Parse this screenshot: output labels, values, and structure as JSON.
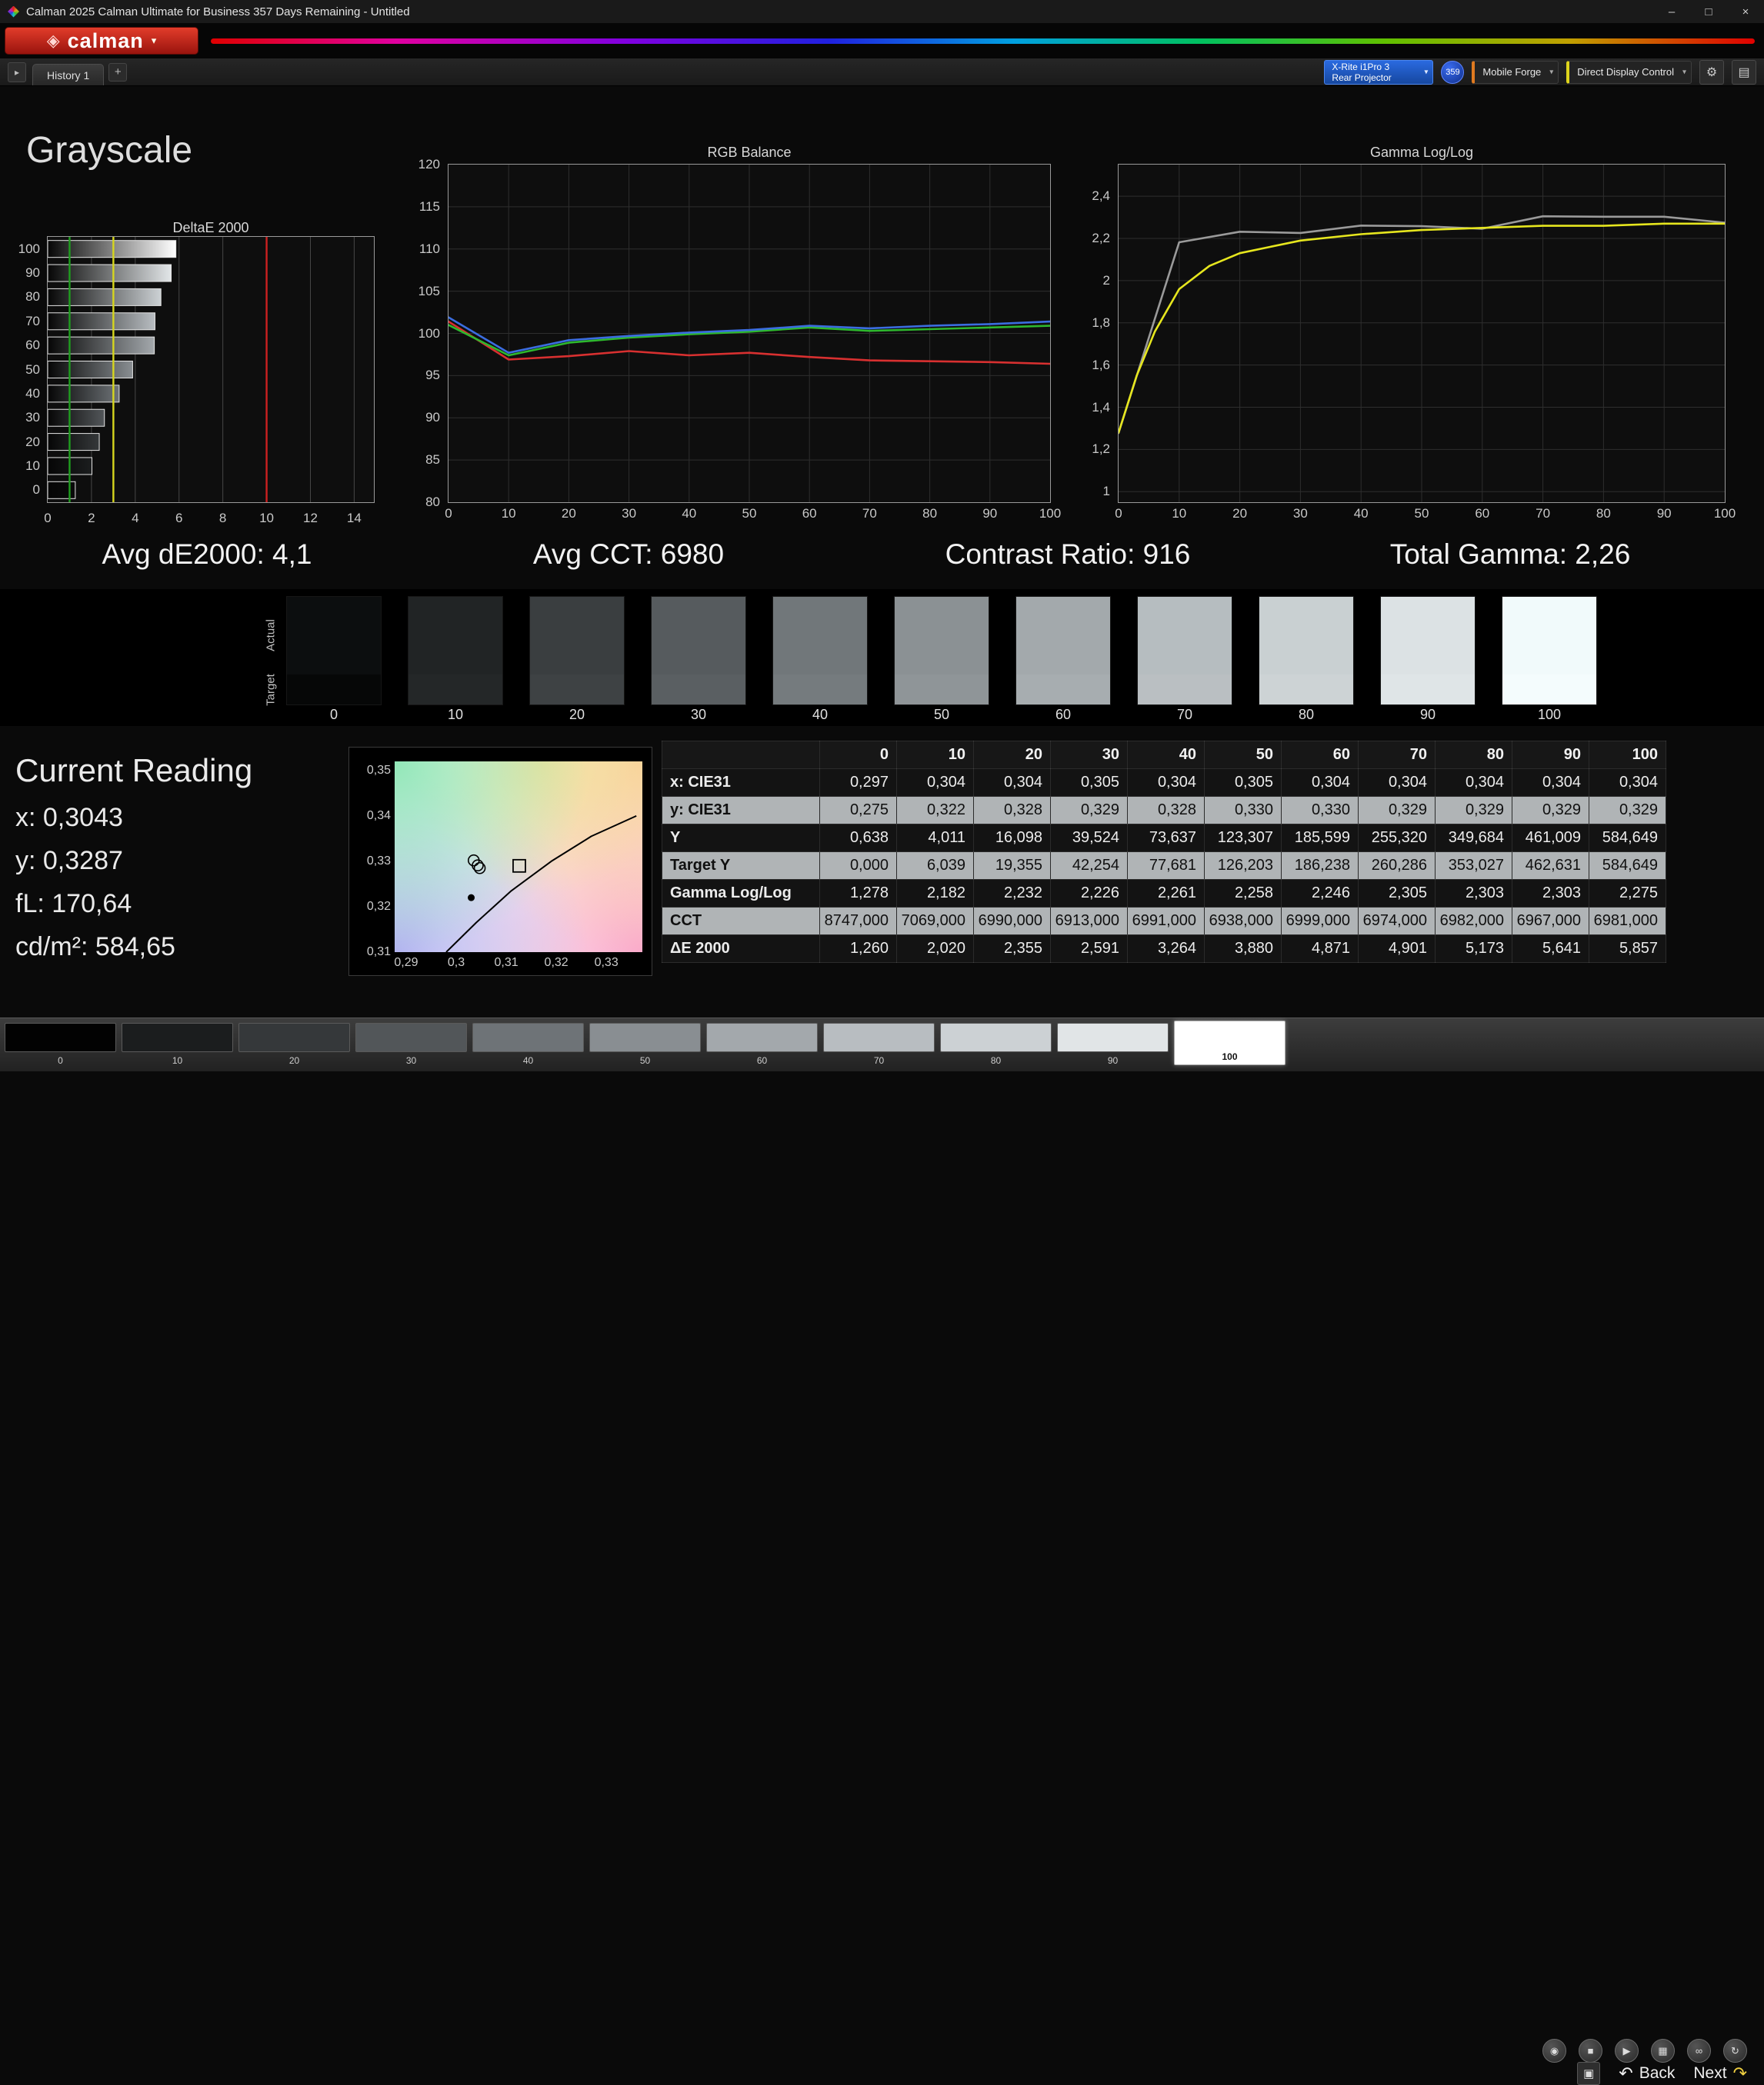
{
  "window": {
    "title": "Calman 2025 Calman Ultimate for Business 357 Days Remaining  - Untitled",
    "minimize": "–",
    "maximize": "□",
    "close": "×"
  },
  "brand": {
    "name": "calman",
    "gem": "◈",
    "caret": "▾"
  },
  "toolbar": {
    "expander": "▸",
    "history_tab": "History 1",
    "add": "+",
    "meter": {
      "line1": "X-Rite i1Pro 3",
      "line2": "Rear Projector"
    },
    "badge": "359",
    "source": "Mobile Forge",
    "display": "Direct Display Control",
    "gear": "⚙",
    "panel": "▤",
    "caret": "▾"
  },
  "page": {
    "title": "Grayscale"
  },
  "summary": {
    "avg_de": "Avg dE2000: 4,1",
    "avg_cct": "Avg CCT: 6980",
    "contrast": "Contrast Ratio: 916",
    "total_gamma": "Total Gamma: 2,26"
  },
  "current_reading": {
    "title": "Current Reading",
    "lines": [
      "x: 0,3043",
      "y: 0,3287",
      "fL: 170,64",
      "cd/m²: 584,65"
    ]
  },
  "swatch_strip": {
    "row_labels": [
      "Actual",
      "Target"
    ],
    "steps": [
      {
        "label": "0",
        "actual": "#0c0e0f",
        "target": "#060707"
      },
      {
        "label": "10",
        "actual": "#212425",
        "target": "#242728"
      },
      {
        "label": "20",
        "actual": "#3a3e40",
        "target": "#3e4244"
      },
      {
        "label": "30",
        "actual": "#565b5e",
        "target": "#5a5f62"
      },
      {
        "label": "40",
        "actual": "#71777a",
        "target": "#757b7e"
      },
      {
        "label": "50",
        "actual": "#8b9194",
        "target": "#8f9598"
      },
      {
        "label": "60",
        "actual": "#a3a9ac",
        "target": "#a7adb0"
      },
      {
        "label": "70",
        "actual": "#b6bdc0",
        "target": "#babfc2"
      },
      {
        "label": "80",
        "actual": "#c9d0d2",
        "target": "#cdd3d5"
      },
      {
        "label": "90",
        "actual": "#dce2e4",
        "target": "#dfe5e7"
      },
      {
        "label": "100",
        "actual": "#f1fafb",
        "target": "#f4fcfd"
      }
    ]
  },
  "table": {
    "columns": [
      "0",
      "10",
      "20",
      "30",
      "40",
      "50",
      "60",
      "70",
      "80",
      "90",
      "100"
    ],
    "rows": [
      {
        "label": "x: CIE31",
        "tone": "dark",
        "values": [
          "0,297",
          "0,304",
          "0,304",
          "0,305",
          "0,304",
          "0,305",
          "0,304",
          "0,304",
          "0,304",
          "0,304",
          "0,304"
        ]
      },
      {
        "label": "y: CIE31",
        "tone": "light",
        "values": [
          "0,275",
          "0,322",
          "0,328",
          "0,329",
          "0,328",
          "0,330",
          "0,330",
          "0,329",
          "0,329",
          "0,329",
          "0,329"
        ]
      },
      {
        "label": "Y",
        "tone": "dark",
        "values": [
          "0,638",
          "4,011",
          "16,098",
          "39,524",
          "73,637",
          "123,307",
          "185,599",
          "255,320",
          "349,684",
          "461,009",
          "584,649"
        ]
      },
      {
        "label": "Target Y",
        "tone": "light",
        "values": [
          "0,000",
          "6,039",
          "19,355",
          "42,254",
          "77,681",
          "126,203",
          "186,238",
          "260,286",
          "353,027",
          "462,631",
          "584,649"
        ]
      },
      {
        "label": "Gamma Log/Log",
        "tone": "dark",
        "values": [
          "1,278",
          "2,182",
          "2,232",
          "2,226",
          "2,261",
          "2,258",
          "2,246",
          "2,305",
          "2,303",
          "2,303",
          "2,275"
        ]
      },
      {
        "label": "CCT",
        "tone": "light",
        "values": [
          "8747,000",
          "7069,000",
          "6990,000",
          "6913,000",
          "6991,000",
          "6938,000",
          "6999,000",
          "6974,000",
          "6982,000",
          "6967,000",
          "6981,000"
        ]
      },
      {
        "label": "ΔE 2000",
        "tone": "dark",
        "values": [
          "1,260",
          "2,020",
          "2,355",
          "2,591",
          "3,264",
          "3,880",
          "4,871",
          "4,901",
          "5,173",
          "5,641",
          "5,857"
        ]
      }
    ]
  },
  "chart_data": [
    {
      "type": "bar",
      "title": "DeltaE 2000",
      "orientation": "horizontal",
      "categories": [
        "100",
        "90",
        "80",
        "70",
        "60",
        "50",
        "40",
        "30",
        "20",
        "10",
        "0"
      ],
      "values": [
        5.857,
        5.641,
        5.173,
        4.901,
        4.871,
        3.88,
        3.264,
        2.591,
        2.355,
        2.02,
        1.26
      ],
      "xlim": [
        0,
        14.9
      ],
      "xticks": [
        0,
        2,
        4,
        6,
        8,
        10,
        12,
        14
      ],
      "bar_end_colors": [
        "#ffffff",
        "#e2e6e8",
        "#ccd1d4",
        "#b8bdc1",
        "#a3a8ac",
        "#898e92",
        "#6e7377",
        "#525659",
        "#35383a",
        "#1b1d1e",
        "#0a0a0a"
      ],
      "reference_lines": [
        {
          "x": 1,
          "color": "#1f9e1f"
        },
        {
          "x": 3,
          "color": "#d6d61e"
        },
        {
          "x": 10,
          "color": "#cc2020"
        }
      ]
    },
    {
      "type": "line",
      "title": "RGB Balance",
      "x": [
        0,
        10,
        20,
        30,
        40,
        50,
        60,
        70,
        80,
        90,
        100
      ],
      "xticks": [
        0,
        10,
        20,
        30,
        40,
        50,
        60,
        70,
        80,
        90,
        100
      ],
      "ylim": [
        80,
        120
      ],
      "yticks": [
        80,
        85,
        90,
        95,
        100,
        105,
        110,
        115,
        120
      ],
      "series": [
        {
          "name": "Red",
          "color": "#d83030",
          "values": [
            101.4,
            96.9,
            97.3,
            97.9,
            97.4,
            97.7,
            97.2,
            96.8,
            96.7,
            96.6,
            96.4
          ]
        },
        {
          "name": "Green",
          "color": "#2eb82e",
          "values": [
            101.0,
            97.4,
            98.9,
            99.5,
            99.9,
            100.2,
            100.7,
            100.3,
            100.5,
            100.7,
            100.9
          ]
        },
        {
          "name": "Blue",
          "color": "#3b6de0",
          "values": [
            101.9,
            97.7,
            99.2,
            99.7,
            100.1,
            100.4,
            100.9,
            100.6,
            100.9,
            101.1,
            101.4
          ]
        }
      ]
    },
    {
      "type": "line",
      "title": "Gamma Log/Log",
      "x": [
        0,
        10,
        20,
        30,
        40,
        50,
        60,
        70,
        80,
        90,
        100
      ],
      "xticks": [
        0,
        10,
        20,
        30,
        40,
        50,
        60,
        70,
        80,
        90,
        100
      ],
      "ylim": [
        0.95,
        2.55
      ],
      "yticks": [
        1,
        1.2,
        1.4,
        1.6,
        1.8,
        2,
        2.2,
        2.4
      ],
      "series": [
        {
          "name": "Measured",
          "color": "#9a9a9a",
          "x": [
            0,
            10,
            20,
            30,
            40,
            50,
            60,
            70,
            80,
            90,
            100
          ],
          "values": [
            1.278,
            2.182,
            2.232,
            2.226,
            2.261,
            2.258,
            2.246,
            2.305,
            2.303,
            2.303,
            2.275
          ]
        },
        {
          "name": "Target",
          "color": "#e6e61e",
          "x": [
            0,
            3,
            6,
            10,
            15,
            20,
            25,
            30,
            40,
            50,
            60,
            70,
            80,
            90,
            100
          ],
          "values": [
            1.28,
            1.55,
            1.76,
            1.96,
            2.07,
            2.13,
            2.16,
            2.19,
            2.22,
            2.24,
            2.25,
            2.26,
            2.26,
            2.27,
            2.27
          ]
        }
      ]
    },
    {
      "type": "scatter",
      "title": "CIE xy detail",
      "xlim": [
        0.2877,
        0.3372
      ],
      "ylim": [
        0.31,
        0.352
      ],
      "xticks": [
        0.29,
        0.3,
        0.31,
        0.32,
        0.33
      ],
      "yticks": [
        0.31,
        0.32,
        0.33,
        0.34,
        0.35
      ],
      "locus": [
        [
          0.298,
          0.31
        ],
        [
          0.304,
          0.3165
        ],
        [
          0.311,
          0.3235
        ],
        [
          0.319,
          0.33
        ],
        [
          0.327,
          0.3355
        ],
        [
          0.336,
          0.34
        ]
      ],
      "points": [
        {
          "x": 0.3035,
          "y": 0.3302,
          "type": "circle"
        },
        {
          "x": 0.3043,
          "y": 0.3291,
          "type": "circle"
        },
        {
          "x": 0.3047,
          "y": 0.3285,
          "type": "circle"
        },
        {
          "x": 0.303,
          "y": 0.322,
          "type": "dot"
        },
        {
          "x": 0.3126,
          "y": 0.329,
          "type": "square"
        }
      ]
    }
  ],
  "bottom_bar": {
    "swatches": [
      {
        "label": "0",
        "color": "#020202"
      },
      {
        "label": "10",
        "color": "#1b1d1e"
      },
      {
        "label": "20",
        "color": "#35383a"
      },
      {
        "label": "30",
        "color": "#525659"
      },
      {
        "label": "40",
        "color": "#6e7377"
      },
      {
        "label": "50",
        "color": "#898e92"
      },
      {
        "label": "60",
        "color": "#a3a8ac"
      },
      {
        "label": "70",
        "color": "#b8bdc1"
      },
      {
        "label": "80",
        "color": "#ccd1d4"
      },
      {
        "label": "90",
        "color": "#e1e5e7"
      },
      {
        "label": "100",
        "color": "#ffffff",
        "selected": true
      }
    ],
    "tools": [
      {
        "name": "capture",
        "glyph": "◉"
      },
      {
        "name": "stop",
        "glyph": "■"
      },
      {
        "name": "play",
        "glyph": "▶"
      },
      {
        "name": "grid",
        "glyph": "▦"
      },
      {
        "name": "loop",
        "glyph": "∞"
      },
      {
        "name": "rotate",
        "glyph": "↻"
      }
    ],
    "window_button_glyph": "▣",
    "back": "Back",
    "next": "Next",
    "back_icon": "↶",
    "next_icon": "↷"
  }
}
